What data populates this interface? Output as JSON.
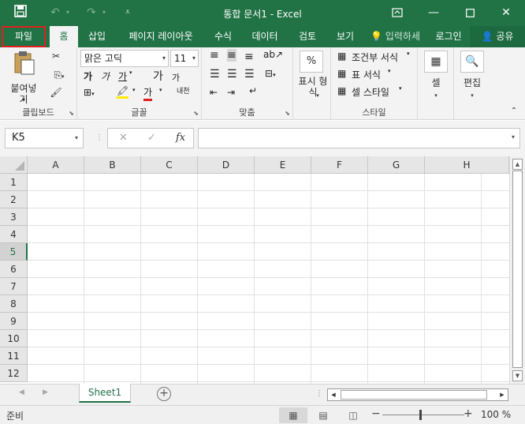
{
  "titlebar": {
    "title": "통합 문서1 - Excel",
    "icons": [
      "save-icon",
      "undo-icon",
      "redo-icon",
      "customize-icon",
      "ribbon-display-icon",
      "minimize-icon",
      "maximize-icon",
      "close-icon"
    ],
    "bg": "#217346"
  },
  "tabs": {
    "file": "파일",
    "home": "홈",
    "insert": "삽입",
    "page_layout": "페이지 레이아웃",
    "formulas": "수식",
    "data": "데이터",
    "review": "검토",
    "view": "보기",
    "tell_me": "입력하세",
    "signin": "로그인",
    "share": "공유"
  },
  "ribbon": {
    "clipboard": {
      "paste": "붙여넣기",
      "label": "클립보드"
    },
    "font": {
      "name": "맑은 고딕",
      "size": "11",
      "bold": "가",
      "italic": "가",
      "underline": "가",
      "grow": "가",
      "shrink": "가",
      "color_letter": "가",
      "phonetic": "내천",
      "label": "글꼴"
    },
    "alignment": {
      "label": "맞춤"
    },
    "number": {
      "format": "표시 형식",
      "percent": "%"
    },
    "styles": {
      "conditional": "조건부 서식",
      "table": "표 서식",
      "cell_styles": "셀 스타일",
      "label": "스타일"
    },
    "cells": {
      "label": "셀"
    },
    "editing": {
      "label": "편집"
    }
  },
  "formula_bar": {
    "namebox": "K5",
    "cancel": "✕",
    "enter": "✓",
    "fx": "fx",
    "value": ""
  },
  "grid": {
    "columns": [
      "A",
      "B",
      "C",
      "D",
      "E",
      "F",
      "G",
      "H"
    ],
    "rows": [
      "1",
      "2",
      "3",
      "4",
      "5",
      "6",
      "7",
      "8",
      "9",
      "10",
      "11",
      "12"
    ],
    "selected_row": "5"
  },
  "sheets": {
    "tabs": [
      "Sheet1"
    ],
    "add": "+"
  },
  "status": {
    "ready": "준비",
    "zoom": "100 %",
    "minus": "−",
    "plus": "+"
  }
}
